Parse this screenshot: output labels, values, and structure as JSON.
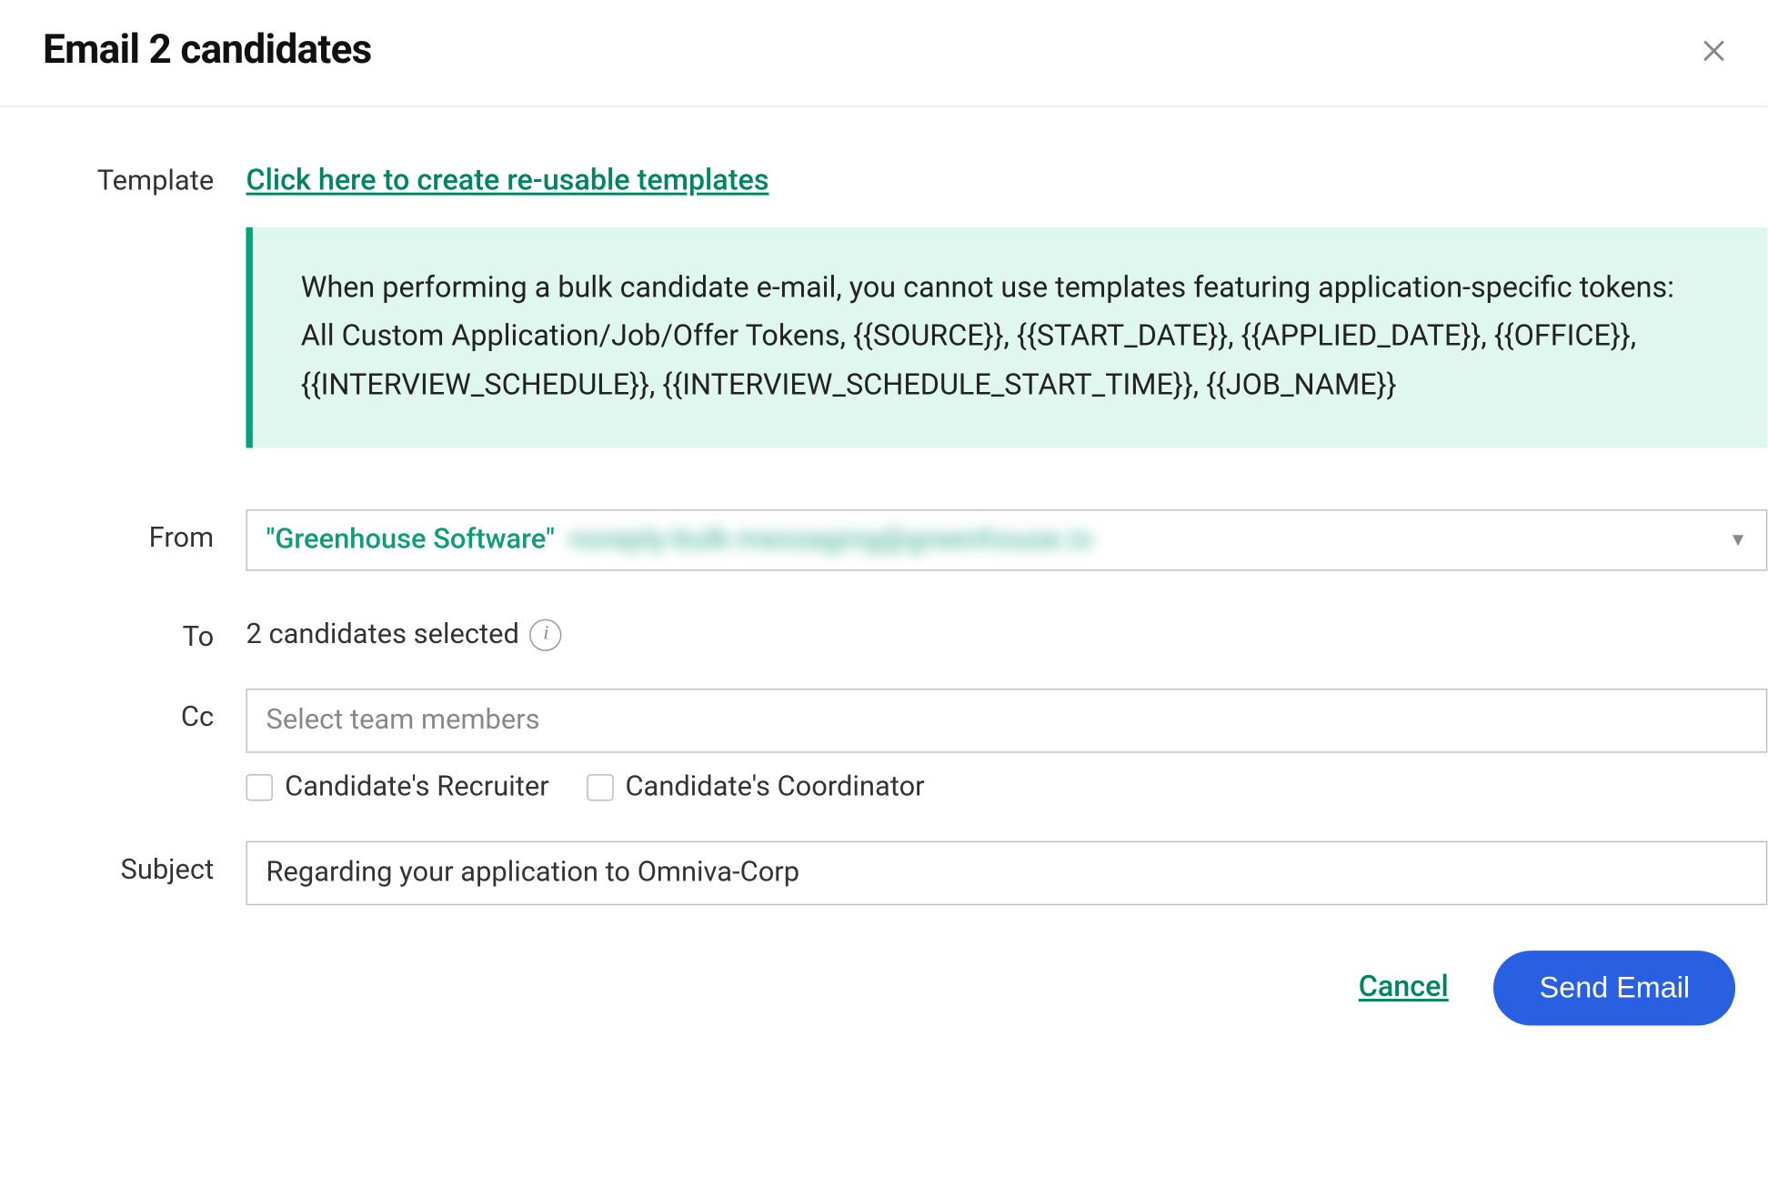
{
  "header": {
    "title": "Email 2 candidates"
  },
  "template": {
    "label": "Template",
    "link_text": "Click here to create re-usable templates",
    "info_line1": "When performing a bulk candidate e-mail, you cannot use templates featuring application-specific tokens:",
    "info_line2": "All Custom Application/Job/Offer Tokens, {{SOURCE}}, {{START_DATE}}, {{APPLIED_DATE}}, {{OFFICE}}, {{INTERVIEW_SCHEDULE}}, {{INTERVIEW_SCHEDULE_START_TIME}}, {{JOB_NAME}}"
  },
  "from": {
    "label": "From",
    "value_visible": "\"Greenhouse Software\"",
    "value_obscured": "noreply-bulk-messaging@greenhouse.io"
  },
  "to": {
    "label": "To",
    "value": "2 candidates selected"
  },
  "cc": {
    "label": "Cc",
    "placeholder": "Select team members",
    "checkbox_recruiter": "Candidate's Recruiter",
    "checkbox_coordinator": "Candidate's Coordinator"
  },
  "subject": {
    "label": "Subject",
    "value": "Regarding your application to Omniva-Corp"
  },
  "footer": {
    "cancel": "Cancel",
    "send": "Send Email"
  }
}
